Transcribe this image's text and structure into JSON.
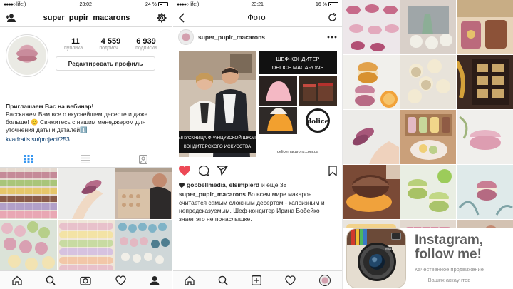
{
  "profile_screen": {
    "status": {
      "carrier": "life:)",
      "time": "23:02",
      "battery": "24 %"
    },
    "username": "super_pupir_macarons",
    "stats": [
      {
        "value": "11",
        "label": "публика..."
      },
      {
        "value": "4 559",
        "label": "подписч..."
      },
      {
        "value": "6 939",
        "label": "подписки"
      }
    ],
    "edit_profile_label": "Редактировать профиль",
    "bio": {
      "line1": "Приглашаем Вас на вебинар!",
      "line2": "Расскажем Вам все о вкуснейшем десерте и даже больше! 😊 Свяжитесь с нашим менеджером для уточнения даты и деталей⬇️",
      "link": "kvadratis.su/project/253"
    },
    "icons": [
      "add-user-icon",
      "gear-icon",
      "grid-icon",
      "list-icon",
      "tagged-icon",
      "home-icon",
      "search-icon",
      "camera-icon",
      "heart-icon",
      "profile-icon"
    ]
  },
  "post_screen": {
    "status": {
      "carrier": "life:)",
      "time": "23:21",
      "battery": "16 %"
    },
    "title": "Фото",
    "post_user": "super_pupir_macarons",
    "image_text": {
      "banner_top_1": "ШЕФ-КОНДИТЕР",
      "banner_top_2": "DELICE MACARONS",
      "banner_bottom_1": "ВЫПУСКНИЦА ФРАНЦУЗСКОЙ ШКОЛЫ",
      "banner_bottom_2": "КОНДИТЕРСКОГО ИСКУССТВА",
      "logo_text": "dolice",
      "site": "delicemacarons.com.ua"
    },
    "likes": {
      "users": "gobbellmedia, elsimplerd",
      "rest": "и еще 38"
    },
    "caption": {
      "user": "super_pupir_macarons",
      "text": "Во всем мире макарон считается самым сложным десертом - капризным и непредсказуемым. Шеф-кондитер Ирина Бобейко знает это не понаслышке."
    }
  },
  "promo": {
    "title_line1": "Instagram,",
    "title_line2": "follow me!",
    "subtitle_line1": "Качественное продвижение",
    "subtitle_line2": "Ваших аккаунтов",
    "logo_label": "Insta"
  },
  "colors": {
    "link": "#003569",
    "like_red": "#ed4956",
    "macaron_pink": "#d89aab",
    "macaron_green": "#b9d07a"
  }
}
